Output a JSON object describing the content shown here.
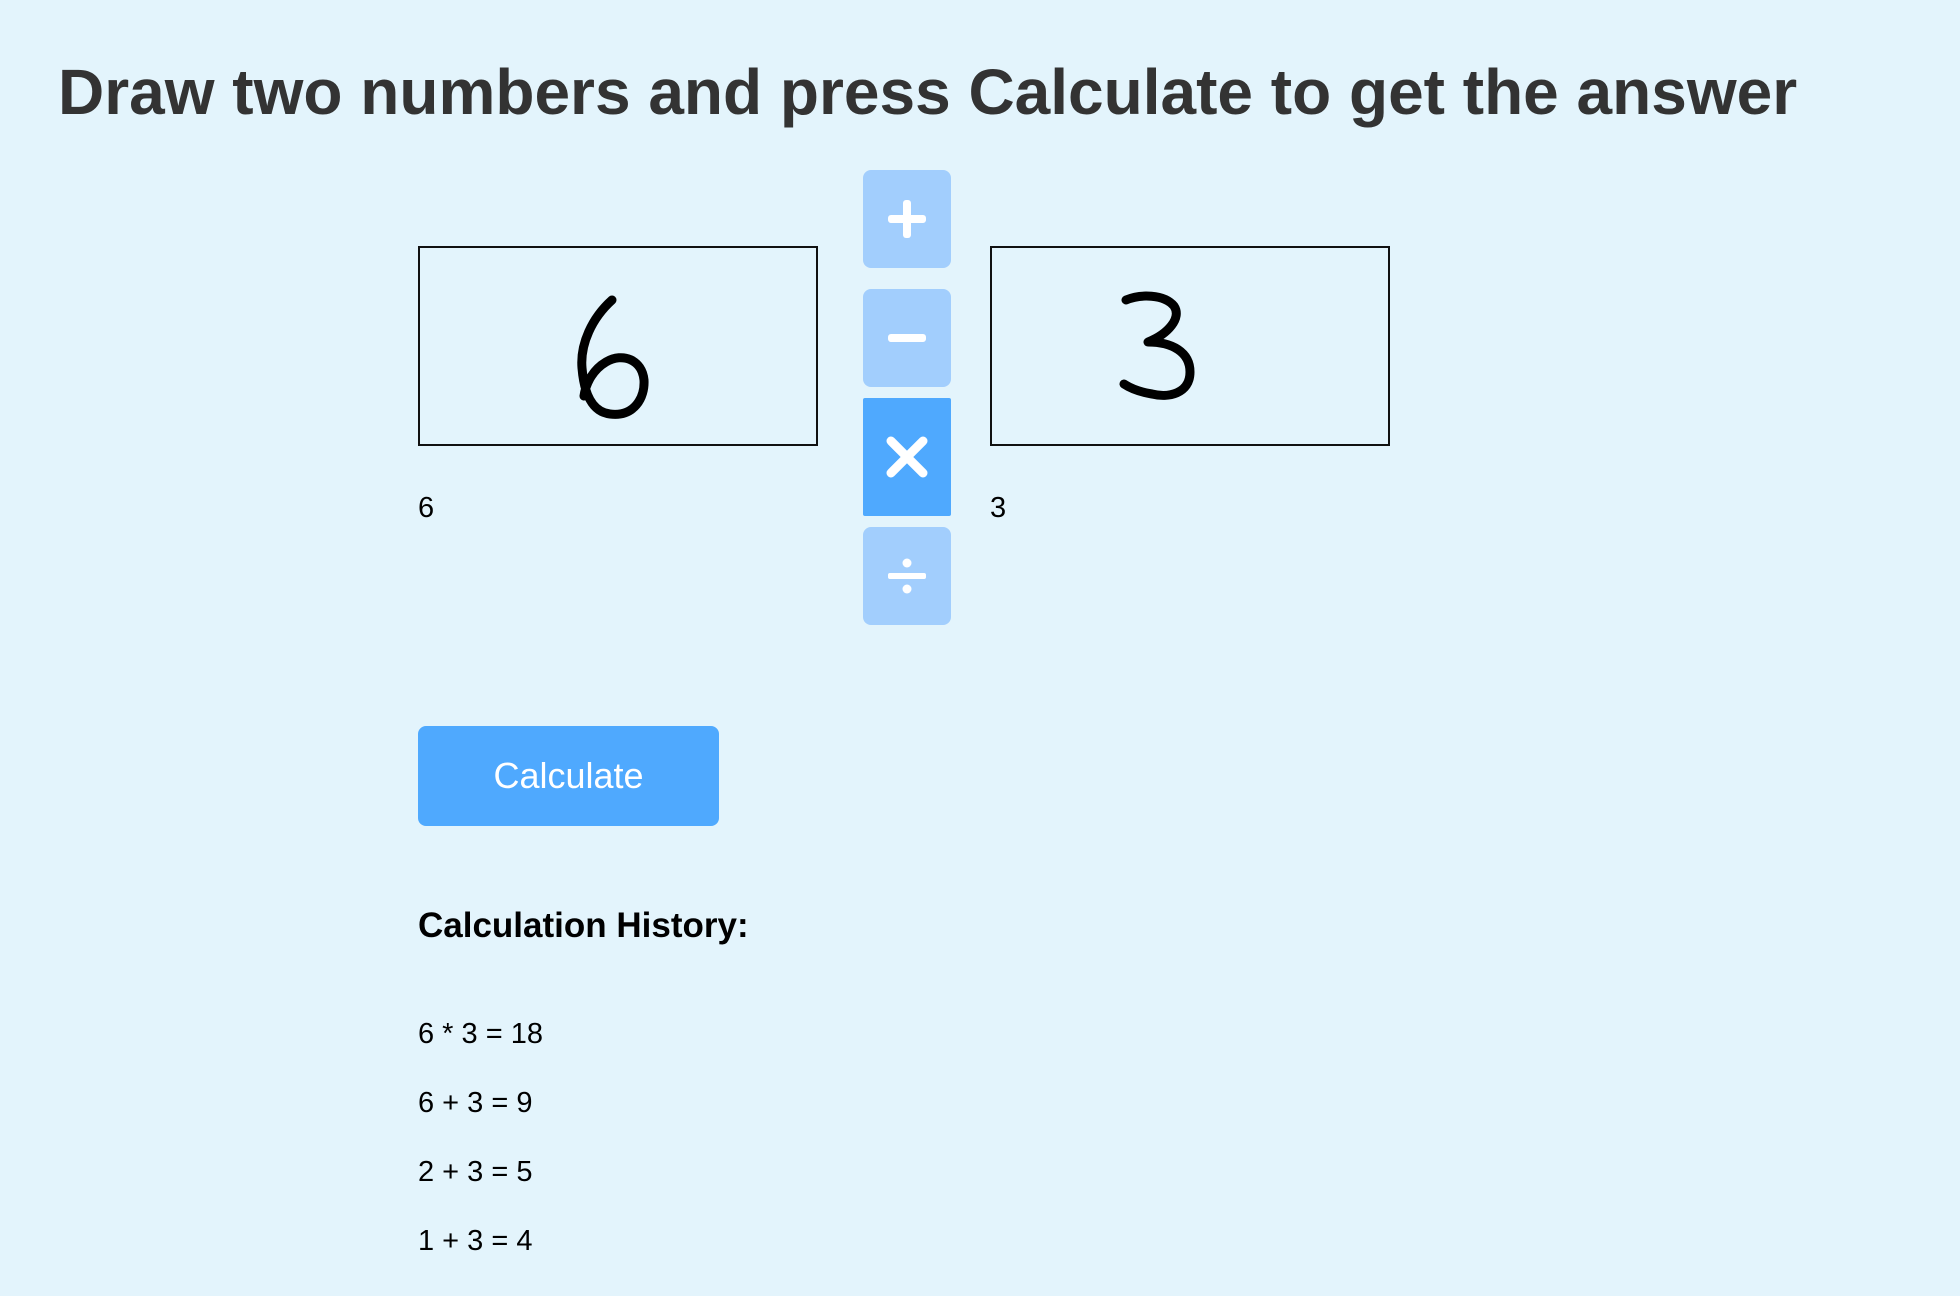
{
  "page": {
    "title": "Draw two numbers and press Calculate to get the answer"
  },
  "canvases": {
    "left": {
      "drawn_digit": "6",
      "prediction": "6"
    },
    "right": {
      "drawn_digit": "3",
      "prediction": "3"
    }
  },
  "operators": [
    {
      "symbol": "+",
      "icon": "plus-icon",
      "selected": false
    },
    {
      "symbol": "−",
      "icon": "minus-icon",
      "selected": false
    },
    {
      "symbol": "×",
      "icon": "times-icon",
      "selected": true
    },
    {
      "symbol": "÷",
      "icon": "divide-icon",
      "selected": false
    }
  ],
  "actions": {
    "calculate_label": "Calculate"
  },
  "history": {
    "heading": "Calculation History:",
    "items": [
      "6 * 3 = 18",
      "6 + 3 = 9",
      "2 + 3 = 5",
      "1 + 3 = 4"
    ]
  },
  "colors": {
    "background": "#e3f4fc",
    "accent": "#4fa9fe",
    "operator_inactive": "#a2cefd",
    "title_text": "#333333"
  }
}
